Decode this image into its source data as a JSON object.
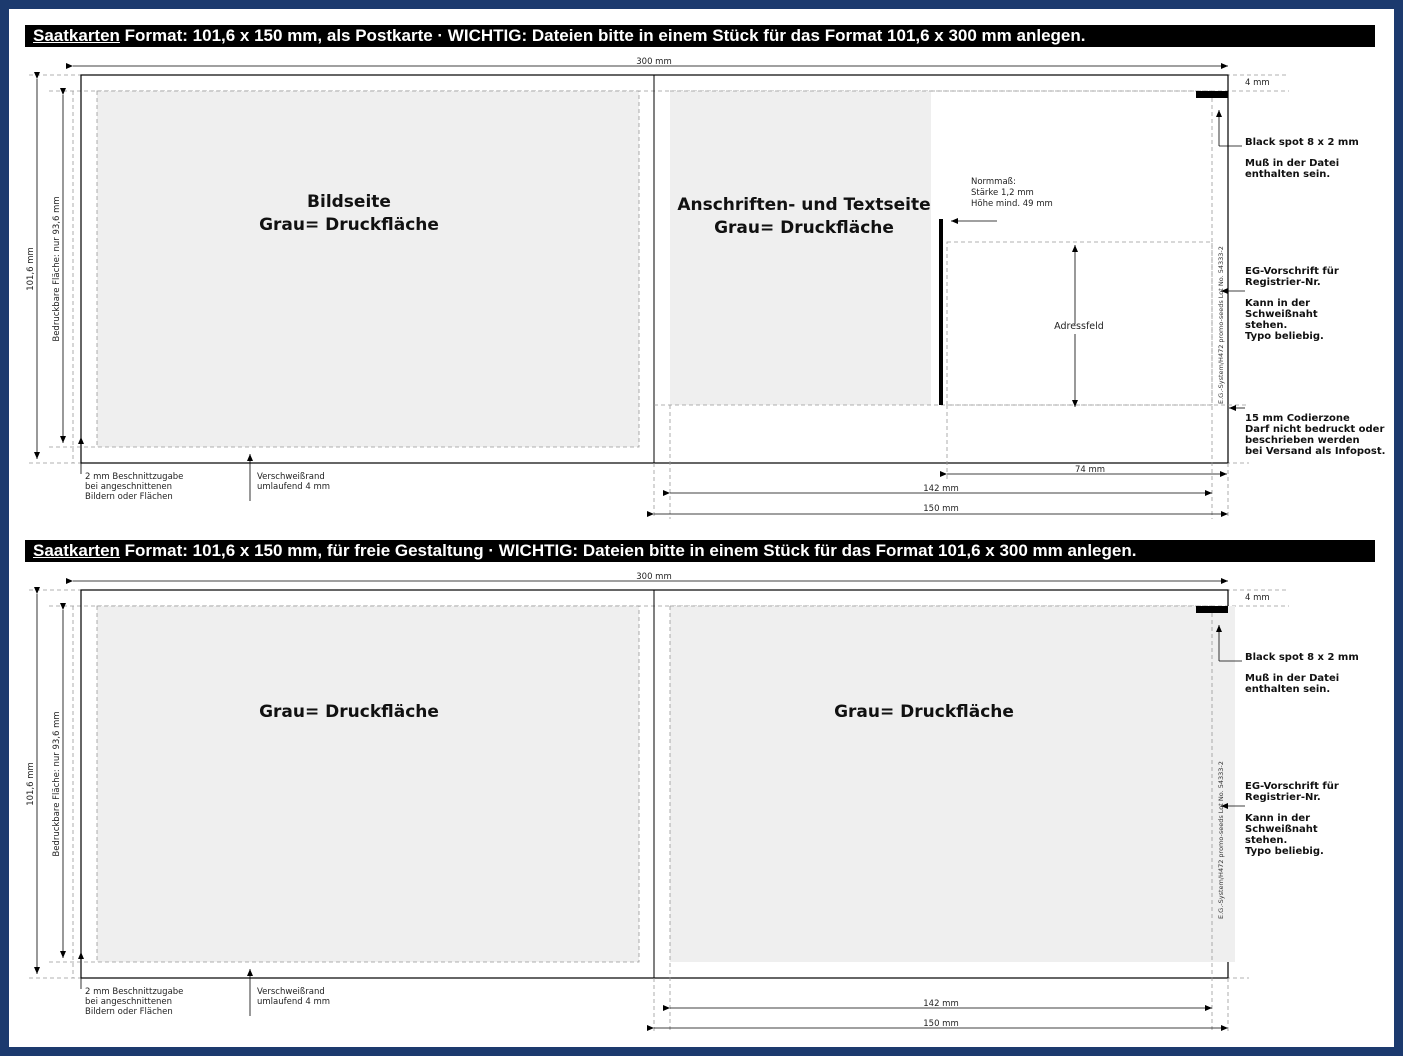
{
  "sections": [
    {
      "title": {
        "brand": "Saatkarten",
        "text": " Format: 101,6 x 150 mm, als Postkarte · WICHTIG: Dateien bitte in einem Stück für das Format 101,6 x 300 mm anlegen."
      },
      "dims": {
        "total": "300 mm",
        "bleed_top": "4 mm",
        "height": "101,6 mm",
        "printable": "Bedruckbare Fläche: nur 93,6 mm",
        "width_142": "142 mm",
        "width_150": "150 mm",
        "width_74": "74 mm"
      },
      "left_panel": {
        "line1": "Bildseite",
        "line2": "Grau= Druckfläche"
      },
      "right_panel": {
        "line1": "Anschriften- und Textseite",
        "line2": "Grau= Druckfläche"
      },
      "normmass": {
        "l1": "Normmaß:",
        "l2": "Stärke 1,2 mm",
        "l3": "Höhe mind. 49 mm"
      },
      "address_label": "Adressfeld",
      "reg_vertical": "E.G.-System/H472 promo-seeds Lot No. 54333-2",
      "notes": {
        "black_spot": "Black spot 8 x 2 mm",
        "muss1": "Muß in der Datei",
        "muss2": "enthalten sein.",
        "eg1": "EG-Vorschrift für",
        "eg2": "Registrier-Nr.",
        "kann1": "Kann in der",
        "kann2": "Schweißnaht",
        "kann3": "stehen.",
        "kann4": "Typo beliebig.",
        "code1": "15 mm Codierzone",
        "code2": "Darf nicht bedruckt oder",
        "code3": "beschrieben werden",
        "code4": "bei Versand als Infopost."
      },
      "bottom_notes": {
        "b1": "2 mm Beschnittzugabe",
        "b2": "bei angeschnittenen",
        "b3": "Bildern oder Flächen",
        "v1": "Verschweißrand",
        "v2": "umlaufend 4 mm"
      }
    },
    {
      "title": {
        "brand": "Saatkarten",
        "text": " Format: 101,6 x 150 mm, für freie Gestaltung · WICHTIG: Dateien bitte in einem Stück für das Format 101,6 x 300 mm anlegen."
      },
      "dims": {
        "total": "300 mm",
        "bleed_top": "4 mm",
        "height": "101,6 mm",
        "printable": "Bedruckbare Fläche: nur 93,6 mm",
        "width_142": "142 mm",
        "width_150": "150 mm"
      },
      "left_panel": {
        "line1": "Grau= Druckfläche"
      },
      "right_panel": {
        "line1": "Grau= Druckfläche"
      },
      "reg_vertical": "E.G.-System/H472 promo-seeds Lot No. 54333-2",
      "notes": {
        "black_spot": "Black spot 8 x 2 mm",
        "muss1": "Muß in der Datei",
        "muss2": "enthalten sein.",
        "eg1": "EG-Vorschrift für",
        "eg2": "Registrier-Nr.",
        "kann1": "Kann in der",
        "kann2": "Schweißnaht",
        "kann3": "stehen.",
        "kann4": "Typo beliebig."
      },
      "bottom_notes": {
        "b1": "2 mm Beschnittzugabe",
        "b2": "bei angeschnittenen",
        "b3": "Bildern oder Flächen",
        "v1": "Verschweißrand",
        "v2": "umlaufend 4 mm"
      }
    }
  ],
  "colors": {
    "frame": "#1c3a6e",
    "print_area": "#efefef",
    "title_bar": "#000000"
  }
}
